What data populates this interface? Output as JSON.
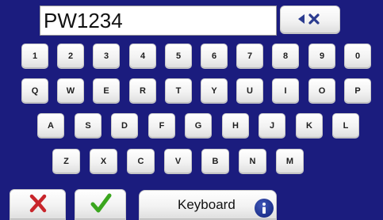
{
  "entry": {
    "value": "PW1234"
  },
  "keys": {
    "row1": [
      "1",
      "2",
      "3",
      "4",
      "5",
      "6",
      "7",
      "8",
      "9",
      "0"
    ],
    "row2": [
      "Q",
      "W",
      "E",
      "R",
      "T",
      "Y",
      "U",
      "I",
      "O",
      "P"
    ],
    "row3": [
      "A",
      "S",
      "D",
      "F",
      "G",
      "H",
      "J",
      "K",
      "L"
    ],
    "row4": [
      "Z",
      "X",
      "C",
      "V",
      "B",
      "N",
      "M"
    ]
  },
  "bottom": {
    "keyboard_label": "Keyboard"
  },
  "icons": {
    "backspace": "backspace-icon",
    "cancel": "red-x-icon",
    "confirm": "green-checkmark-icon",
    "info": "info-icon"
  },
  "colors": {
    "background": "#1b1c7e",
    "cancel": "#c8252b",
    "confirm": "#3aa61e",
    "info": "#1a2f8c"
  }
}
